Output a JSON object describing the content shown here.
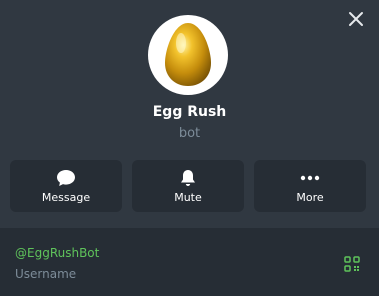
{
  "profile": {
    "name": "Egg Rush",
    "subtitle": "bot"
  },
  "actions": [
    {
      "label": "Message",
      "icon": "chat-bubble-icon"
    },
    {
      "label": "Mute",
      "icon": "bell-icon"
    },
    {
      "label": "More",
      "icon": "more-dots-icon"
    }
  ],
  "info": {
    "username": "@EggRushBot",
    "username_caption": "Username",
    "qr_icon": "qr-code-icon"
  },
  "colors": {
    "background": "#303841",
    "panel": "#262d35",
    "accent_green": "#5fc35b",
    "muted_text": "#7d8c99"
  }
}
